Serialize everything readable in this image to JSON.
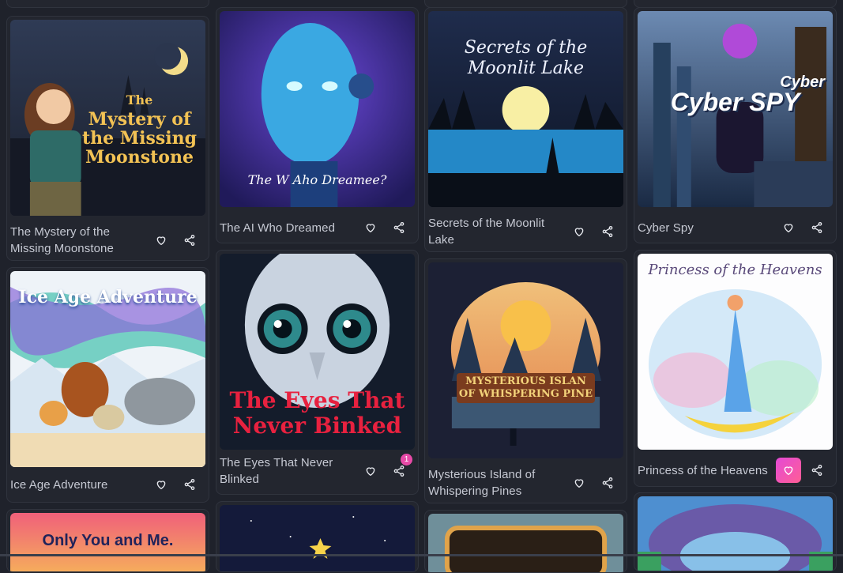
{
  "colors": {
    "background": "#1f222b",
    "card": "#23262f",
    "text": "#c6c9d3",
    "accent": "#ee4fc0",
    "badge": "#e84aa7"
  },
  "icons": {
    "like": "heart-icon",
    "share": "share-icon"
  },
  "stories": [
    {
      "title": "The Mystery of the Missing Moonstone",
      "cover_text": [
        "The",
        "Mystery of",
        "the Missing",
        "Moonstone"
      ],
      "liked": false,
      "share_count": ""
    },
    {
      "title": "The AI Who Dreamed",
      "cover_text": [
        "The W Aho Dreamee?"
      ],
      "liked": false,
      "share_count": ""
    },
    {
      "title": "Secrets of the Moonlit Lake",
      "cover_text": [
        "Secrets of the",
        "Moonlit Lake"
      ],
      "liked": false,
      "share_count": ""
    },
    {
      "title": "Cyber Spy",
      "cover_text": [
        "Cyber",
        "Cyber SPY"
      ],
      "liked": false,
      "share_count": ""
    },
    {
      "title": "Ice Age Adventure",
      "cover_text": [
        "Ice Age Adventure"
      ],
      "liked": false,
      "share_count": ""
    },
    {
      "title": "The Eyes That Never Blinked",
      "cover_text": [
        "The Eyes That",
        "Never Binked"
      ],
      "liked": false,
      "share_count": "1"
    },
    {
      "title": "Mysterious Island of Whispering Pines",
      "cover_text": [
        "MYSTERIOUS ISLAN",
        "OF WHISPERING PINE"
      ],
      "liked": false,
      "share_count": ""
    },
    {
      "title": "Princess of the Heavens",
      "cover_text": [
        "Princess of the Heavens"
      ],
      "liked": true,
      "share_count": ""
    },
    {
      "title": "",
      "cover_text": [
        "Only You and Me."
      ],
      "liked": false,
      "share_count": ""
    }
  ]
}
